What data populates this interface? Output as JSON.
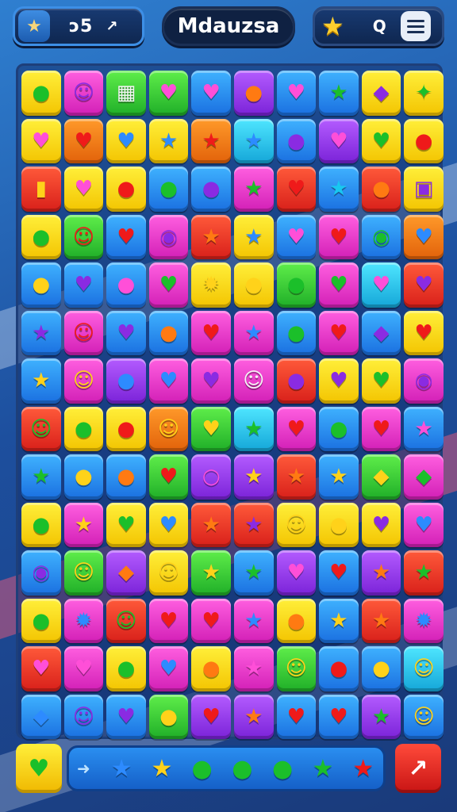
{
  "header": {
    "score": "ↄ5",
    "arrow_glyph": "↗",
    "title": "Mdauzsa",
    "home_icon": "★",
    "star_icon": "★",
    "search_icon": "Q"
  },
  "board": {
    "rows": [
      [
        [
          "yellow",
          "●",
          "green"
        ],
        [
          "pink",
          "☺",
          "purple"
        ],
        [
          "green",
          "▦",
          "white"
        ],
        [
          "green",
          "♥",
          "pink"
        ],
        [
          "blue",
          "♥",
          "pink"
        ],
        [
          "purple",
          "●",
          "orange"
        ],
        [
          "blue",
          "♥",
          "pink"
        ],
        [
          "blue",
          "★",
          "green"
        ],
        [
          "yellow",
          "◆",
          "purple"
        ],
        [
          "yellow",
          "✦",
          "green"
        ]
      ],
      [
        [
          "yellow",
          "♥",
          "pink"
        ],
        [
          "orange",
          "♥",
          "red"
        ],
        [
          "yellow",
          "♥",
          "blue"
        ],
        [
          "yellow",
          "★",
          "blue"
        ],
        [
          "orange",
          "★",
          "red"
        ],
        [
          "cyan",
          "★",
          "blue"
        ],
        [
          "blue",
          "●",
          "purple"
        ],
        [
          "purple",
          "♥",
          "pink"
        ],
        [
          "yellow",
          "♥",
          "green"
        ],
        [
          "yellow",
          "●",
          "red"
        ]
      ],
      [
        [
          "red",
          "▮",
          "yellow"
        ],
        [
          "yellow",
          "♥",
          "pink"
        ],
        [
          "yellow",
          "●",
          "red"
        ],
        [
          "blue",
          "●",
          "green"
        ],
        [
          "blue",
          "●",
          "purple"
        ],
        [
          "pink",
          "★",
          "green"
        ],
        [
          "red",
          "♥",
          "red"
        ],
        [
          "blue",
          "★",
          "cyan"
        ],
        [
          "red",
          "●",
          "orange"
        ],
        [
          "yellow",
          "▣",
          "purple"
        ]
      ],
      [
        [
          "yellow",
          "●",
          "green"
        ],
        [
          "green",
          "☺",
          "red"
        ],
        [
          "blue",
          "♥",
          "red"
        ],
        [
          "pink",
          "◉",
          "purple"
        ],
        [
          "red",
          "★",
          "orange"
        ],
        [
          "yellow",
          "★",
          "blue"
        ],
        [
          "blue",
          "♥",
          "pink"
        ],
        [
          "pink",
          "♥",
          "red"
        ],
        [
          "blue",
          "◉",
          "green"
        ],
        [
          "orange",
          "♥",
          "blue"
        ]
      ],
      [
        [
          "blue",
          "●",
          "yellow"
        ],
        [
          "blue",
          "♥",
          "purple"
        ],
        [
          "blue",
          "●",
          "pink"
        ],
        [
          "pink",
          "♥",
          "green"
        ],
        [
          "yellow",
          "✹",
          "yellow"
        ],
        [
          "yellow",
          "●",
          "yellow"
        ],
        [
          "green",
          "●",
          "green"
        ],
        [
          "pink",
          "♥",
          "green"
        ],
        [
          "cyan",
          "♥",
          "pink"
        ],
        [
          "red",
          "♥",
          "purple"
        ]
      ],
      [
        [
          "blue",
          "★",
          "purple"
        ],
        [
          "pink",
          "☺",
          "red"
        ],
        [
          "blue",
          "♥",
          "purple"
        ],
        [
          "blue",
          "●",
          "orange"
        ],
        [
          "pink",
          "♥",
          "red"
        ],
        [
          "pink",
          "★",
          "blue"
        ],
        [
          "blue",
          "●",
          "green"
        ],
        [
          "pink",
          "♥",
          "red"
        ],
        [
          "blue",
          "◆",
          "purple"
        ],
        [
          "yellow",
          "♥",
          "red"
        ]
      ],
      [
        [
          "blue",
          "★",
          "yellow"
        ],
        [
          "pink",
          "☺",
          "yellow"
        ],
        [
          "purple",
          "●",
          "blue"
        ],
        [
          "pink",
          "♥",
          "blue"
        ],
        [
          "pink",
          "♥",
          "purple"
        ],
        [
          "pink",
          "☺",
          "white"
        ],
        [
          "red",
          "●",
          "purple"
        ],
        [
          "yellow",
          "♥",
          "purple"
        ],
        [
          "yellow",
          "♥",
          "green"
        ],
        [
          "pink",
          "◉",
          "purple"
        ]
      ],
      [
        [
          "red",
          "☺",
          "green"
        ],
        [
          "yellow",
          "●",
          "green"
        ],
        [
          "yellow",
          "●",
          "red"
        ],
        [
          "orange",
          "☺",
          "yellow"
        ],
        [
          "green",
          "♥",
          "yellow"
        ],
        [
          "cyan",
          "★",
          "green"
        ],
        [
          "pink",
          "♥",
          "red"
        ],
        [
          "blue",
          "●",
          "green"
        ],
        [
          "pink",
          "♥",
          "red"
        ],
        [
          "blue",
          "★",
          "pink"
        ]
      ],
      [
        [
          "blue",
          "★",
          "green"
        ],
        [
          "blue",
          "●",
          "yellow"
        ],
        [
          "blue",
          "●",
          "orange"
        ],
        [
          "green",
          "♥",
          "red"
        ],
        [
          "purple",
          "○",
          "pink"
        ],
        [
          "purple",
          "★",
          "yellow"
        ],
        [
          "red",
          "★",
          "orange"
        ],
        [
          "blue",
          "★",
          "yellow"
        ],
        [
          "green",
          "◆",
          "yellow"
        ],
        [
          "pink",
          "◆",
          "green"
        ]
      ],
      [
        [
          "yellow",
          "●",
          "green"
        ],
        [
          "pink",
          "★",
          "yellow"
        ],
        [
          "yellow",
          "♥",
          "green"
        ],
        [
          "yellow",
          "♥",
          "blue"
        ],
        [
          "red",
          "★",
          "orange"
        ],
        [
          "red",
          "★",
          "purple"
        ],
        [
          "yellow",
          "☺",
          "yellow"
        ],
        [
          "yellow",
          "●",
          "yellow"
        ],
        [
          "yellow",
          "♥",
          "purple"
        ],
        [
          "pink",
          "♥",
          "blue"
        ]
      ],
      [
        [
          "blue",
          "◉",
          "purple"
        ],
        [
          "green",
          "☺",
          "yellow"
        ],
        [
          "purple",
          "◆",
          "orange"
        ],
        [
          "yellow",
          "☺",
          "yellow"
        ],
        [
          "green",
          "★",
          "yellow"
        ],
        [
          "blue",
          "★",
          "green"
        ],
        [
          "purple",
          "♥",
          "pink"
        ],
        [
          "blue",
          "♥",
          "red"
        ],
        [
          "purple",
          "★",
          "orange"
        ],
        [
          "red",
          "★",
          "green"
        ]
      ],
      [
        [
          "yellow",
          "●",
          "green"
        ],
        [
          "pink",
          "✹",
          "blue"
        ],
        [
          "red",
          "☺",
          "green"
        ],
        [
          "pink",
          "♥",
          "red"
        ],
        [
          "pink",
          "♥",
          "red"
        ],
        [
          "pink",
          "★",
          "blue"
        ],
        [
          "yellow",
          "●",
          "orange"
        ],
        [
          "blue",
          "★",
          "yellow"
        ],
        [
          "red",
          "★",
          "orange"
        ],
        [
          "pink",
          "✹",
          "blue"
        ]
      ],
      [
        [
          "red",
          "♥",
          "pink"
        ],
        [
          "pink",
          "♥",
          "pink"
        ],
        [
          "yellow",
          "●",
          "green"
        ],
        [
          "pink",
          "♥",
          "blue"
        ],
        [
          "yellow",
          "●",
          "orange"
        ],
        [
          "pink",
          "★",
          "pink"
        ],
        [
          "green",
          "☺",
          "yellow"
        ],
        [
          "blue",
          "●",
          "red"
        ],
        [
          "blue",
          "●",
          "yellow"
        ],
        [
          "cyan",
          "☺",
          "yellow"
        ]
      ],
      [
        [
          "blue",
          "◆",
          "blue"
        ],
        [
          "blue",
          "☺",
          "purple"
        ],
        [
          "blue",
          "♥",
          "purple"
        ],
        [
          "green",
          "●",
          "yellow"
        ],
        [
          "purple",
          "♥",
          "red"
        ],
        [
          "purple",
          "★",
          "orange"
        ],
        [
          "blue",
          "♥",
          "red"
        ],
        [
          "blue",
          "♥",
          "red"
        ],
        [
          "purple",
          "★",
          "green"
        ],
        [
          "blue",
          "☺",
          "yellow"
        ]
      ]
    ]
  },
  "footer": {
    "left_icon": "♥",
    "tray_arrow": "➜",
    "tray_items": [
      [
        "★",
        "blue"
      ],
      [
        "★",
        "yellow"
      ],
      [
        "●",
        "green"
      ],
      [
        "●",
        "green"
      ],
      [
        "●",
        "green"
      ],
      [
        "★",
        "green"
      ],
      [
        "★",
        "red"
      ]
    ],
    "right_icon": "↗"
  }
}
